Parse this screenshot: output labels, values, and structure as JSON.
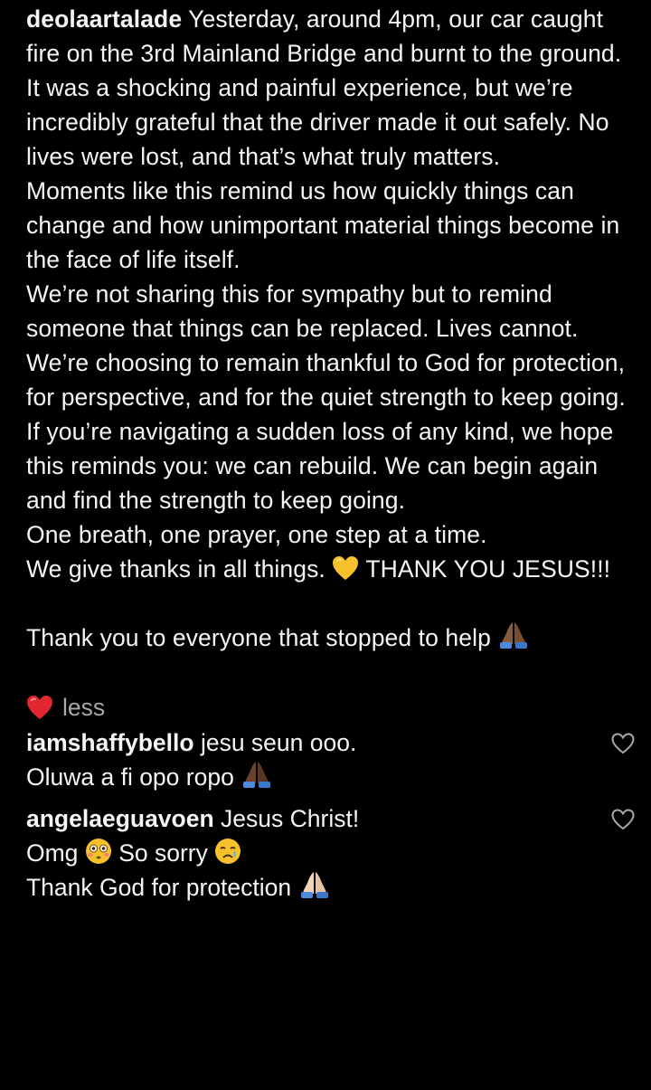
{
  "post": {
    "username": "deolaartalade",
    "caption_first_line": "Yesterday, around 4pm, our car caught fire on the 3rd Mainland Bridge and burnt to the ground.",
    "paragraphs": [
      " It was a shocking and painful experience, but we’re incredibly grateful that the driver made it out safely. No lives were lost, and that’s what truly matters.",
      "Moments like this remind us how quickly things can change and how unimportant material things become in the face of life itself.",
      "We’re not sharing this for sympathy but to remind someone that things can be replaced. Lives cannot.",
      "We’re choosing to remain thankful to God for protection, for perspective, and for the quiet strength to keep going.",
      "If you’re navigating a sudden loss of any kind, we hope this reminds you: we can rebuild. We can begin again and find the strength to keep going.",
      "One breath, one prayer, one step at a time."
    ],
    "thanks_before": "We give thanks in all things.",
    "thanks_after": "THANK YOU JESUS!!!",
    "closing": "Thank you to everyone that stopped to help",
    "less_label": "less"
  },
  "comments": [
    {
      "username": "iamshaffybello",
      "text_first": "jesu seun ooo.",
      "text_second": "Oluwa a fi opo ropo"
    },
    {
      "username": "angelaeguavoen",
      "text_first": "Jesus Christ!",
      "text_second_a": "Omg",
      "text_second_b": "So sorry",
      "text_third": "Thank God for protection"
    }
  ],
  "icons": {
    "yellow_heart": "yellow-heart-emoji",
    "red_heart": "red-heart-emoji",
    "pray_dark": "folded-hands-dark-emoji",
    "pray_light": "folded-hands-light-emoji",
    "flushed": "flushed-face-emoji",
    "crying": "crying-face-emoji",
    "like": "heart-outline-icon"
  },
  "colors": {
    "background": "#000000",
    "text": "#f5f5f5",
    "muted": "#a8a8a8",
    "red_heart": "#e0262e",
    "yellow_heart": "#f7c12b"
  }
}
